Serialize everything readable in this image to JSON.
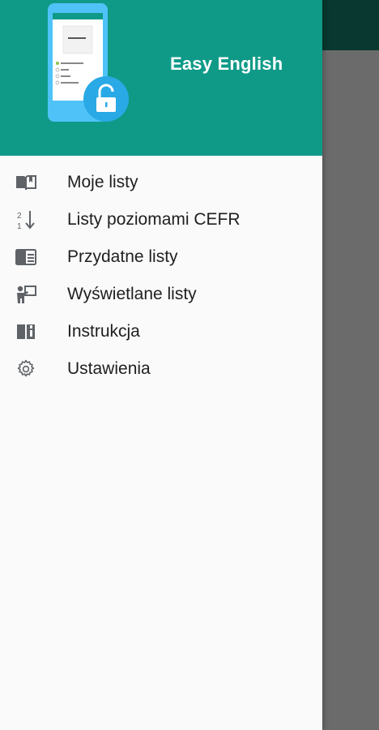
{
  "drawer": {
    "app_title": "Easy English",
    "items": [
      {
        "label": "Moje listy",
        "icon": "book-open-icon"
      },
      {
        "label": "Listy poziomami CEFR",
        "icon": "sort-numeric-icon"
      },
      {
        "label": "Przydatne listy",
        "icon": "list-card-icon"
      },
      {
        "label": "Wyświetlane listy",
        "icon": "presenter-icon"
      },
      {
        "label": "Instrukcja",
        "icon": "manual-book-icon"
      },
      {
        "label": "Ustawienia",
        "icon": "gear-icon"
      }
    ]
  },
  "colors": {
    "header": "#0f9a88",
    "toolbar_dimmed": "#08382f",
    "scrim": "#6b6b6b",
    "drawer_bg": "#fafafa",
    "icon": "#5f6368",
    "phone": "#4fc3f7",
    "unlock_badge": "#29a9e6"
  }
}
